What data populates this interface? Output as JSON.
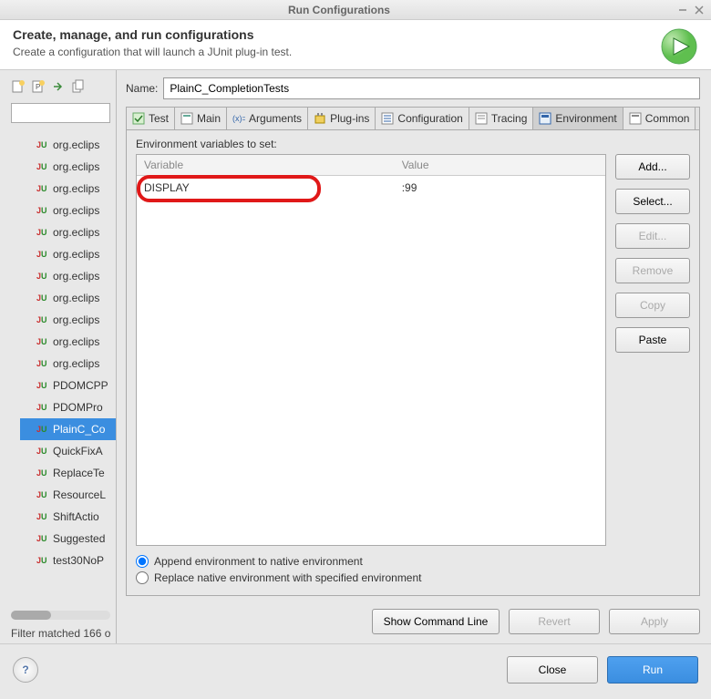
{
  "window": {
    "title": "Run Configurations"
  },
  "header": {
    "title": "Create, manage, and run configurations",
    "subtitle": "Create a configuration that will launch a JUnit plug-in test."
  },
  "sidebar": {
    "filter_value": "",
    "items": [
      {
        "label": "org.eclips"
      },
      {
        "label": "org.eclips"
      },
      {
        "label": "org.eclips"
      },
      {
        "label": "org.eclips"
      },
      {
        "label": "org.eclips"
      },
      {
        "label": "org.eclips"
      },
      {
        "label": "org.eclips"
      },
      {
        "label": "org.eclips"
      },
      {
        "label": "org.eclips"
      },
      {
        "label": "org.eclips"
      },
      {
        "label": "org.eclips"
      },
      {
        "label": "PDOMCPP"
      },
      {
        "label": "PDOMPro"
      },
      {
        "label": "PlainC_Co",
        "selected": true
      },
      {
        "label": "QuickFixA"
      },
      {
        "label": "ReplaceTe"
      },
      {
        "label": "ResourceL"
      },
      {
        "label": "ShiftActio"
      },
      {
        "label": "Suggested"
      },
      {
        "label": "test30NoP"
      }
    ],
    "status": "Filter matched 166 o"
  },
  "form": {
    "name_label": "Name:",
    "name_value": "PlainC_CompletionTests"
  },
  "tabs": {
    "items": [
      {
        "label": "Test"
      },
      {
        "label": "Main"
      },
      {
        "label": "Arguments"
      },
      {
        "label": "Plug-ins"
      },
      {
        "label": "Configuration"
      },
      {
        "label": "Tracing"
      },
      {
        "label": "Environment",
        "active": true
      },
      {
        "label": "Common"
      }
    ]
  },
  "env": {
    "section_label": "Environment variables to set:",
    "col_variable": "Variable",
    "col_value": "Value",
    "rows": [
      {
        "variable": "DISPLAY",
        "value": ":99"
      }
    ],
    "buttons": {
      "add": "Add...",
      "select": "Select...",
      "edit": "Edit...",
      "remove": "Remove",
      "copy": "Copy",
      "paste": "Paste"
    },
    "radio_append": "Append environment to native environment",
    "radio_replace": "Replace native environment with specified environment"
  },
  "actions": {
    "show_cmd": "Show Command Line",
    "revert": "Revert",
    "apply": "Apply",
    "close": "Close",
    "run": "Run"
  }
}
